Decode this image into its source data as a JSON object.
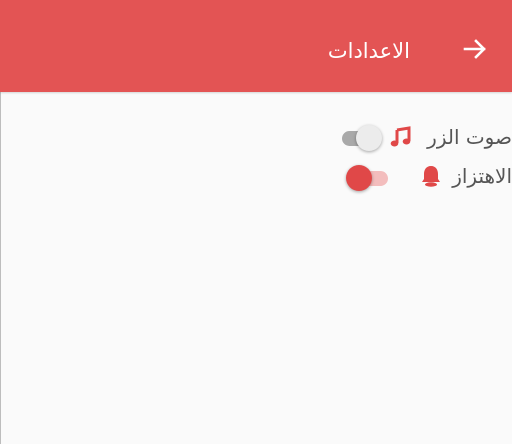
{
  "app_bar": {
    "title": "الاعدادات",
    "back_icon": "arrow-right-icon",
    "color": "#e35454"
  },
  "settings": [
    {
      "label": "صوت الزر",
      "icon": "music-note-icon",
      "enabled": false
    },
    {
      "label": "الاهتزاز",
      "icon": "bell-icon",
      "enabled": true
    }
  ],
  "colors": {
    "accent": "#e04848",
    "switch_track_on": "#f3bdbd",
    "switch_track_off": "#a9a9a9",
    "switch_thumb_off": "#ececec",
    "background": "#fafafa"
  }
}
